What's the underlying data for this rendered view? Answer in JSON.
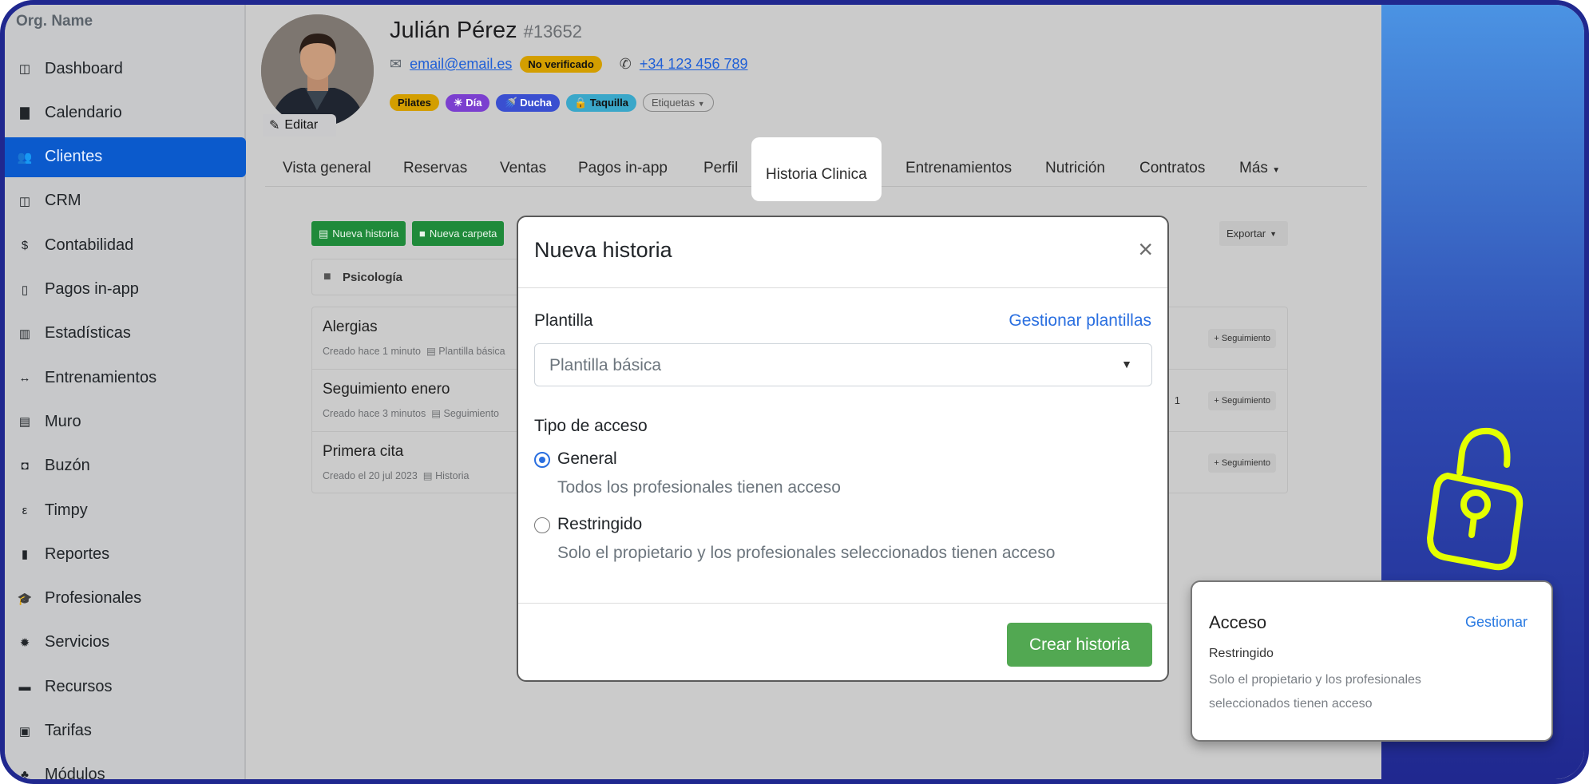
{
  "sidebar": {
    "org_name": "Org. Name",
    "items": [
      {
        "label": "Dashboard",
        "icon": "columns-icon",
        "glyph": "◫"
      },
      {
        "label": "Calendario",
        "icon": "calendar-icon",
        "glyph": "▇"
      },
      {
        "label": "Clientes",
        "icon": "users-icon",
        "glyph": "👥",
        "active": true
      },
      {
        "label": "CRM",
        "icon": "columns-icon",
        "glyph": "◫"
      },
      {
        "label": "Contabilidad",
        "icon": "dollar-icon",
        "glyph": "$"
      },
      {
        "label": "Pagos in-app",
        "icon": "mobile-icon",
        "glyph": "▯"
      },
      {
        "label": "Estadísticas",
        "icon": "chart-bar-icon",
        "glyph": "▥"
      },
      {
        "label": "Entrenamientos",
        "icon": "dumbbell-icon",
        "glyph": "↔"
      },
      {
        "label": "Muro",
        "icon": "newspaper-icon",
        "glyph": "▤"
      },
      {
        "label": "Buzón",
        "icon": "inbox-icon",
        "glyph": "◘"
      },
      {
        "label": "Timpy",
        "icon": "timpy-icon",
        "glyph": "ε"
      },
      {
        "label": "Reportes",
        "icon": "file-download-icon",
        "glyph": "▮"
      },
      {
        "label": "Profesionales",
        "icon": "graduation-cap-icon",
        "glyph": "🎓"
      },
      {
        "label": "Servicios",
        "icon": "certificate-icon",
        "glyph": "✹"
      },
      {
        "label": "Recursos",
        "icon": "archive-icon",
        "glyph": "▬"
      },
      {
        "label": "Tarifas",
        "icon": "money-bill-icon",
        "glyph": "▣"
      },
      {
        "label": "Módulos",
        "icon": "sitemap-icon",
        "glyph": "♣"
      }
    ]
  },
  "client": {
    "name": "Julián Pérez",
    "id": "#13652",
    "edit_label": "Editar",
    "email": "email@email.es",
    "email_status": "No verificado",
    "phone": "+34 123 456 789",
    "tags": [
      {
        "label": "Pilates",
        "color": "#d39e00",
        "icon": ""
      },
      {
        "label": "Día",
        "color": "#7b3fcf",
        "icon": "☀"
      },
      {
        "label": "Ducha",
        "color": "#3a4fd0",
        "icon": "🚿"
      },
      {
        "label": "Taquilla",
        "color": "#3aa7c9",
        "icon": "🔒"
      }
    ],
    "tags_dropdown": "Etiquetas"
  },
  "tabs": [
    "Vista general",
    "Reservas",
    "Ventas",
    "Pagos in-app",
    "Perfil",
    "Historia Clinica",
    "Entrenamientos",
    "Nutrición",
    "Contratos",
    "Más"
  ],
  "active_tab": "Historia Clinica",
  "content": {
    "new_history": "Nueva historia",
    "new_folder": "Nueva carpeta",
    "export": "Exportar",
    "folder": "Psicología",
    "records": [
      {
        "title": "Alergias",
        "created": "Creado hace 1 minuto",
        "template": "Plantilla básica",
        "count": "",
        "action": "+ Seguimiento"
      },
      {
        "title": "Seguimiento enero",
        "created": "Creado hace 3 minutos",
        "template": "Seguimiento",
        "count": "1",
        "action": "+ Seguimiento"
      },
      {
        "title": "Primera cita",
        "created": "Creado el 20 jul 2023",
        "template": "Historia",
        "count": "",
        "action": "+ Seguimiento"
      }
    ]
  },
  "modal": {
    "title": "Nueva historia",
    "template_label": "Plantilla",
    "manage_templates": "Gestionar plantillas",
    "template_value": "Plantilla básica",
    "access_label": "Tipo de acceso",
    "options": [
      {
        "label": "General",
        "desc": "Todos los profesionales tienen acceso",
        "checked": true
      },
      {
        "label": "Restringido",
        "desc": "Solo el propietario y los profesionales seleccionados tienen acceso",
        "checked": false
      }
    ],
    "submit": "Crear historia"
  },
  "access_card": {
    "title": "Acceso",
    "manage": "Gestionar",
    "value": "Restringido",
    "desc": "Solo el propietario y los profesionales seleccionados tienen acceso"
  }
}
